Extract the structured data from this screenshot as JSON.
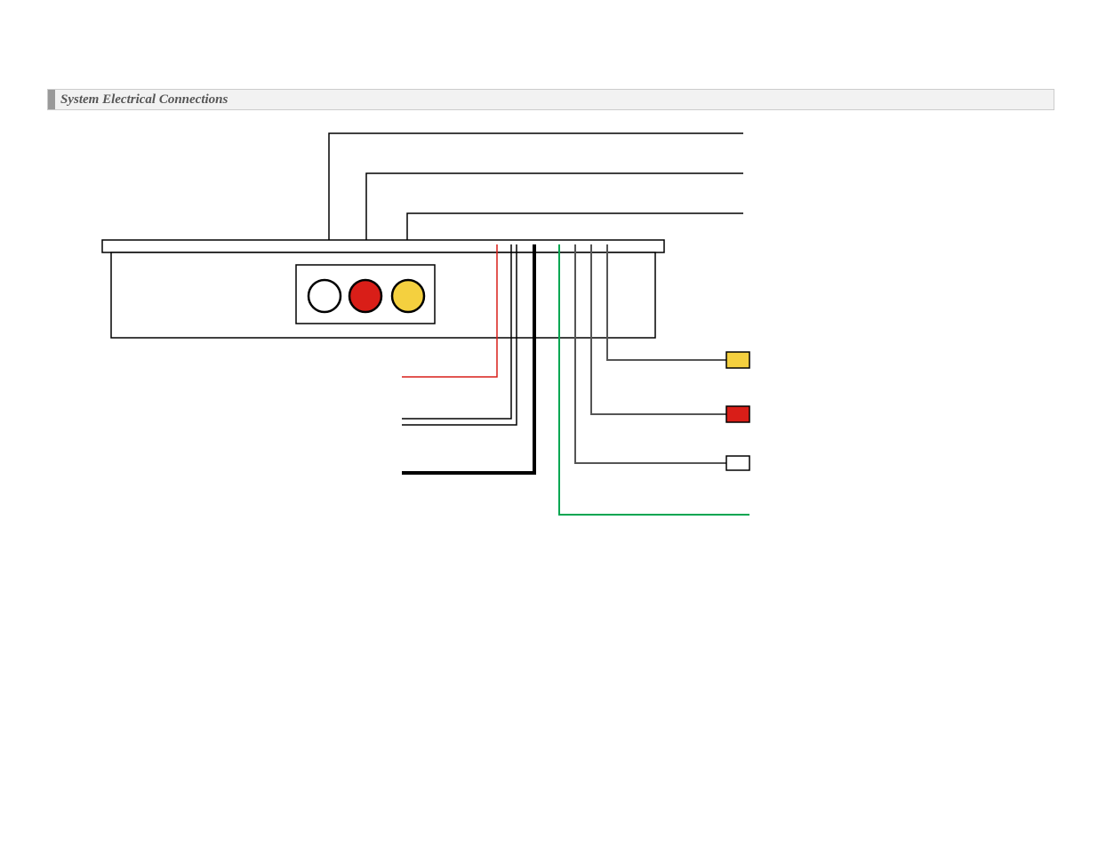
{
  "section": {
    "title": "System Electrical Connections"
  },
  "wiring": {
    "connectors": [
      {
        "name": "rca-white",
        "color": "#ffffff",
        "stroke": "#000000"
      },
      {
        "name": "rca-red",
        "color": "#d91e18",
        "stroke": "#000000"
      },
      {
        "name": "rca-yellow",
        "color": "#f4d03f",
        "stroke": "#000000"
      }
    ],
    "terminals": [
      {
        "name": "terminal-yellow",
        "color": "#f4d03f"
      },
      {
        "name": "terminal-red",
        "color": "#d91e18"
      },
      {
        "name": "terminal-white",
        "color": "#ffffff"
      }
    ],
    "wire_colors": {
      "signal": "#000000",
      "power": "#d91e18",
      "ground": "#00a651"
    }
  }
}
